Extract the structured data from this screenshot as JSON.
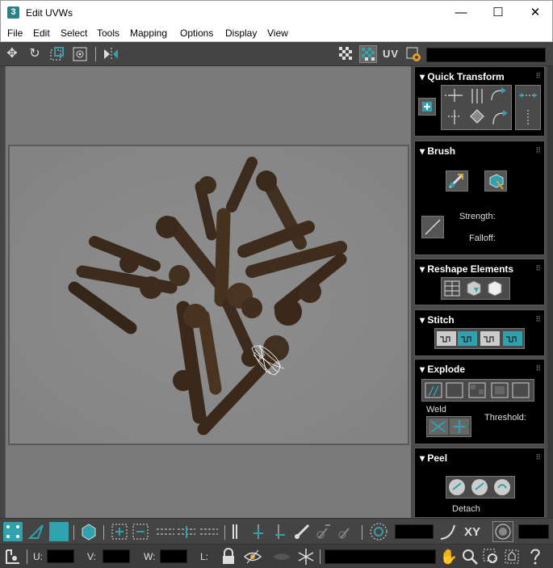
{
  "window": {
    "title": "Edit UVWs",
    "app_icon": "3",
    "minimize": "—",
    "maximize": "☐",
    "close": "✕"
  },
  "menu": [
    "File",
    "Edit",
    "Select",
    "Tools",
    "Mapping",
    "Options",
    "Display",
    "View"
  ],
  "toolbar": {
    "uv_label": "UV",
    "icons": [
      "move-icon",
      "rotate-icon",
      "scale-icon",
      "freeform-icon",
      "mirror-icon",
      "checker-icon",
      "checker-color-icon",
      "uv-options-icon"
    ]
  },
  "rollouts": {
    "quick_transform": {
      "title": "Quick Transform"
    },
    "brush": {
      "title": "Brush",
      "strength_label": "Strength:",
      "falloff_label": "Falloff:"
    },
    "reshape": {
      "title": "Reshape Elements"
    },
    "stitch": {
      "title": "Stitch"
    },
    "explode": {
      "title": "Explode",
      "weld_label": "Weld",
      "threshold_label": "Threshold:"
    },
    "peel": {
      "title": "Peel",
      "detach_label": "Detach"
    }
  },
  "bottom": {
    "xy_label": "XY",
    "u_label": "U:",
    "v_label": "V:",
    "w_label": "W:",
    "l_label": "L:"
  },
  "colors": {
    "accent_teal": "#2fa2ad",
    "panel_bg": "#000000",
    "ui_bg": "#444444"
  }
}
